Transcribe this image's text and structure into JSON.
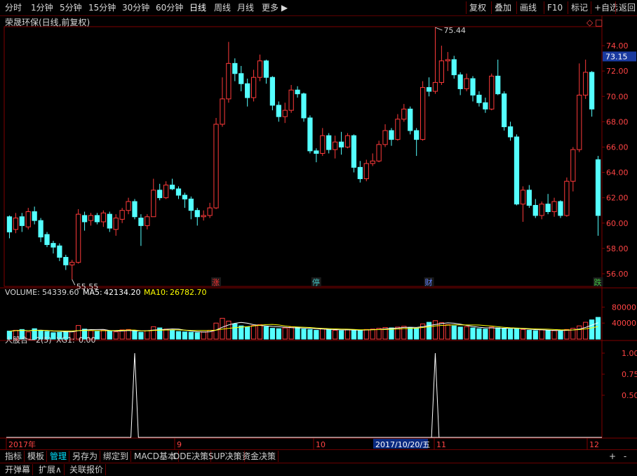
{
  "toolbar": {
    "periods": [
      "分时",
      "1分钟",
      "5分钟",
      "15分钟",
      "30分钟",
      "60分钟",
      "日线",
      "周线",
      "月线",
      "更多"
    ],
    "active_index": 6,
    "more_arrow": "▶",
    "right_buttons": [
      "复权",
      "叠加",
      "画线",
      "F10",
      "标记",
      "+自选",
      "返回"
    ]
  },
  "main_panel": {
    "title": "荣晟环保(日线,前复权)",
    "price_marker": "73.15",
    "high_label": "75.44",
    "low_label": "55.55",
    "y_ticks": [
      "74.00",
      "72.00",
      "70.00",
      "68.00",
      "66.00",
      "64.00",
      "62.00",
      "60.00",
      "58.00",
      "56.00"
    ],
    "markers": [
      "涨",
      "停",
      "财",
      "跌"
    ],
    "diamond_icon": "◇",
    "close_icon": "□"
  },
  "volume_panel": {
    "label": "VOLUME:",
    "value": "54339.60",
    "ma5_label": "MA5:",
    "ma5_value": "42134.20",
    "ma10_label": "MA10:",
    "ma10_value": "26782.70",
    "y_ticks": [
      "80000",
      "40000"
    ]
  },
  "indicator_panel": {
    "label": "人股合一2(5)",
    "xg_label": "XG1:",
    "xg_value": "0.00",
    "y_ticks": [
      "1.00",
      "0.75",
      "0.50"
    ]
  },
  "date_axis": {
    "labels": [
      "2017年",
      "9",
      "10",
      "11",
      "12"
    ],
    "cursor_date": "2017/10/20/五"
  },
  "colors": {
    "up": "#ff3a3a",
    "down": "#54ffff",
    "ma5": "#ffffff",
    "ma10": "#ffff00",
    "grid": "#800000",
    "axis_text": "#ff4444"
  },
  "chart_data": {
    "type": "candlestick",
    "series": [
      {
        "name": "price",
        "values": [
          [
            60.5,
            59.3,
            60.6,
            58.8
          ],
          [
            59.5,
            60.4,
            60.8,
            59.2
          ],
          [
            60.5,
            59.8,
            60.8,
            59.3
          ],
          [
            59.7,
            60.9,
            61.2,
            59.5
          ],
          [
            60.9,
            60.2,
            61.3,
            59.9
          ],
          [
            60.2,
            58.9,
            60.4,
            58.5
          ],
          [
            59.1,
            58.3,
            59.3,
            58.1
          ],
          [
            58.4,
            58.1,
            58.6,
            57.6
          ],
          [
            58.2,
            57.3,
            58.4,
            57.0
          ],
          [
            57.3,
            56.7,
            57.5,
            56.3
          ],
          [
            56.7,
            56.9,
            57.1,
            55.55
          ],
          [
            56.9,
            60.7,
            61.1,
            56.8
          ],
          [
            60.6,
            60.1,
            60.9,
            59.4
          ],
          [
            60.2,
            60.6,
            60.8,
            59.8
          ],
          [
            60.6,
            60.1,
            60.8,
            59.9
          ],
          [
            60.1,
            60.8,
            61.0,
            59.7
          ],
          [
            60.7,
            59.6,
            60.9,
            59.3
          ],
          [
            59.5,
            60.4,
            60.7,
            59.0
          ],
          [
            60.3,
            61.0,
            61.2,
            60.0
          ],
          [
            61.0,
            61.7,
            62.0,
            60.7
          ],
          [
            61.7,
            60.5,
            61.9,
            60.3
          ],
          [
            60.4,
            59.8,
            60.7,
            58.2
          ],
          [
            59.8,
            60.5,
            60.7,
            59.5
          ],
          [
            60.5,
            62.6,
            63.5,
            60.5
          ],
          [
            62.6,
            62.0,
            63.1,
            61.8
          ],
          [
            62.0,
            63.0,
            63.3,
            61.9
          ],
          [
            63.0,
            62.7,
            63.5,
            62.6
          ],
          [
            62.7,
            62.2,
            62.9,
            61.9
          ],
          [
            62.2,
            61.9,
            62.4,
            61.2
          ],
          [
            61.9,
            61.0,
            62.1,
            60.3
          ],
          [
            61.0,
            60.5,
            61.2,
            59.8
          ],
          [
            60.5,
            60.6,
            61.0,
            60.2
          ],
          [
            60.6,
            61.2,
            61.6,
            60.4
          ],
          [
            61.2,
            67.8,
            68.3,
            61.1
          ],
          [
            67.8,
            69.8,
            71.5,
            67.6
          ],
          [
            69.8,
            72.6,
            74.3,
            69.5
          ],
          [
            72.6,
            71.8,
            73.0,
            71.2
          ],
          [
            71.8,
            71.0,
            72.4,
            70.4
          ],
          [
            71.0,
            69.9,
            71.4,
            69.2
          ],
          [
            69.9,
            71.5,
            72.1,
            69.6
          ],
          [
            71.5,
            72.8,
            73.3,
            71.2
          ],
          [
            72.8,
            71.5,
            72.9,
            71.0
          ],
          [
            71.5,
            69.3,
            71.6,
            68.9
          ],
          [
            69.3,
            68.4,
            69.6,
            68.0
          ],
          [
            68.4,
            68.9,
            69.5,
            67.9
          ],
          [
            68.9,
            70.5,
            70.9,
            68.7
          ],
          [
            70.5,
            70.2,
            70.8,
            69.9
          ],
          [
            70.2,
            68.3,
            70.3,
            68.0
          ],
          [
            68.3,
            65.7,
            68.5,
            65.5
          ],
          [
            65.7,
            65.5,
            65.9,
            64.8
          ],
          [
            65.5,
            66.9,
            67.5,
            65.3
          ],
          [
            66.9,
            65.8,
            67.1,
            65.5
          ],
          [
            65.8,
            66.4,
            66.9,
            65.1
          ],
          [
            66.4,
            66.0,
            67.2,
            65.4
          ],
          [
            66.0,
            66.9,
            67.1,
            65.9
          ],
          [
            66.9,
            64.4,
            67.0,
            64.0
          ],
          [
            64.4,
            63.5,
            64.9,
            63.2
          ],
          [
            63.5,
            64.7,
            65.0,
            63.3
          ],
          [
            64.7,
            64.9,
            65.5,
            64.5
          ],
          [
            64.9,
            66.2,
            66.5,
            64.8
          ],
          [
            66.2,
            67.3,
            67.8,
            66.0
          ],
          [
            67.3,
            66.6,
            67.5,
            66.1
          ],
          [
            66.6,
            68.2,
            68.6,
            66.5
          ],
          [
            68.2,
            69.0,
            69.4,
            68.0
          ],
          [
            69.0,
            67.3,
            69.2,
            67.0
          ],
          [
            67.3,
            66.6,
            67.5,
            65.3
          ],
          [
            66.6,
            70.7,
            71.2,
            66.5
          ],
          [
            70.7,
            70.4,
            71.5,
            70.0
          ],
          [
            70.4,
            71.1,
            75.44,
            70.2
          ],
          [
            71.1,
            72.8,
            74.0,
            70.9
          ],
          [
            72.8,
            72.9,
            73.5,
            72.0
          ],
          [
            72.9,
            71.7,
            73.2,
            71.4
          ],
          [
            71.7,
            70.6,
            71.9,
            70.1
          ],
          [
            70.6,
            71.4,
            71.8,
            70.4
          ],
          [
            71.4,
            70.1,
            71.6,
            69.6
          ],
          [
            70.1,
            69.5,
            70.4,
            69.2
          ],
          [
            69.5,
            69.0,
            69.9,
            68.7
          ],
          [
            69.0,
            71.6,
            71.8,
            68.9
          ],
          [
            71.6,
            70.2,
            72.9,
            70.1
          ],
          [
            70.2,
            67.6,
            70.4,
            67.3
          ],
          [
            67.6,
            66.8,
            68.0,
            66.5
          ],
          [
            66.8,
            61.5,
            67.0,
            61.4
          ],
          [
            61.5,
            62.6,
            62.9,
            60.1
          ],
          [
            62.6,
            61.4,
            63.0,
            61.2
          ],
          [
            61.4,
            60.6,
            61.9,
            60.4
          ],
          [
            60.6,
            61.5,
            61.7,
            60.3
          ],
          [
            61.5,
            60.9,
            62.3,
            60.7
          ],
          [
            60.9,
            61.7,
            62.0,
            60.5
          ],
          [
            61.7,
            60.6,
            61.8,
            60.4
          ],
          [
            60.6,
            63.3,
            63.6,
            60.5
          ],
          [
            63.3,
            65.8,
            66.0,
            62.5
          ],
          [
            65.8,
            70.1,
            72.6,
            65.6
          ],
          [
            70.1,
            71.9,
            72.9,
            69.8
          ],
          [
            71.9,
            69.0,
            72.0,
            68.4
          ],
          [
            65.0,
            60.6,
            65.3,
            59.0
          ]
        ]
      },
      {
        "name": "volume",
        "values": [
          20,
          22,
          24,
          18,
          26,
          21,
          19,
          16,
          17,
          18,
          20,
          34,
          25,
          21,
          19,
          22,
          20,
          18,
          23,
          24,
          20,
          17,
          21,
          31,
          28,
          25,
          22,
          19,
          18,
          17,
          16,
          18,
          22,
          40,
          52,
          45,
          38,
          33,
          30,
          34,
          36,
          31,
          27,
          26,
          28,
          30,
          29,
          25,
          24,
          22,
          26,
          24,
          22,
          21,
          24,
          23,
          22,
          24,
          25,
          27,
          29,
          28,
          30,
          32,
          29,
          27,
          38,
          42,
          46,
          41,
          36,
          33,
          30,
          31,
          28,
          26,
          25,
          30,
          28,
          27,
          25,
          26,
          24,
          22,
          21,
          23,
          22,
          21,
          20,
          24,
          27,
          33,
          42,
          48,
          54.3
        ]
      },
      {
        "name": "ind",
        "values": [
          0,
          0,
          0,
          0,
          0,
          0,
          0,
          0,
          0,
          0,
          0,
          0,
          0,
          0,
          0,
          0,
          0,
          0,
          0,
          0,
          1,
          0,
          0,
          0,
          0,
          0,
          0,
          0,
          0,
          0,
          0,
          0,
          0,
          0,
          0,
          0,
          0,
          0,
          0,
          0,
          0,
          0,
          0,
          0,
          0,
          0,
          0,
          0,
          0,
          0,
          0,
          0,
          0,
          0,
          0,
          0,
          0,
          0,
          0,
          0,
          0,
          0,
          0,
          0,
          0,
          0,
          0,
          0,
          0,
          0,
          0,
          0,
          0,
          0,
          0,
          0,
          0,
          0,
          0,
          0,
          0,
          0,
          0,
          0,
          0,
          0,
          0,
          0,
          0,
          0,
          0,
          0,
          0,
          0,
          0,
          0,
          0,
          0
        ]
      }
    ],
    "ylim_price": [
      55,
      75.5
    ],
    "ylim_volume": [
      0,
      100000
    ],
    "ylim_indicator": [
      0,
      1.1
    ]
  }
}
